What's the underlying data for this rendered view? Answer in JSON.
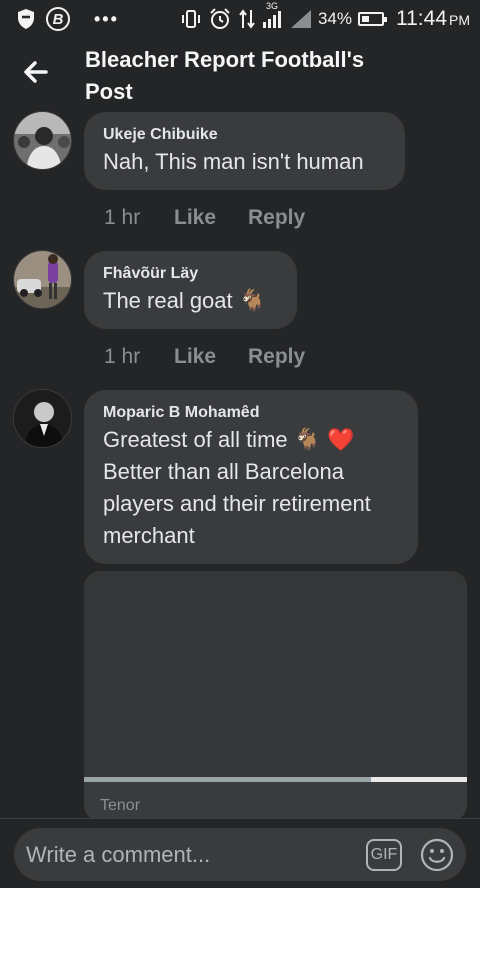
{
  "status_bar": {
    "battery": "34%",
    "time": "11:44",
    "ampm": "PM",
    "network": "3G",
    "icons": [
      "shield-icon",
      "b-app-icon",
      "more-dots-icon",
      "vibrate-icon",
      "alarm-icon",
      "data-transfer-icon",
      "signal-icon",
      "signal-empty-icon",
      "battery-icon"
    ]
  },
  "header": {
    "title": "Bleacher Report Football's Post"
  },
  "comments": [
    {
      "author": "Ukeje Chibuike",
      "text": "Nah, This man isn't human",
      "time": "1 hr",
      "like": "Like",
      "reply": "Reply"
    },
    {
      "author": "Fhâvõür Läy",
      "text": "The real goat 🐐",
      "time": "1 hr",
      "like": "Like",
      "reply": "Reply"
    },
    {
      "author": "Moparic B Mohamêd",
      "text": "Greatest of all time 🐐 ❤️ Better than all Barcelona players and their retirement merchant",
      "gif_source": "Tenor",
      "gif_progress": 0.75
    }
  ],
  "composer": {
    "placeholder": "Write a comment...",
    "gif_label": "GIF"
  },
  "colors": {
    "background": "#242526",
    "bubble": "#3a3b3c",
    "text": "#e4e6eb",
    "muted": "#8a8d91"
  }
}
